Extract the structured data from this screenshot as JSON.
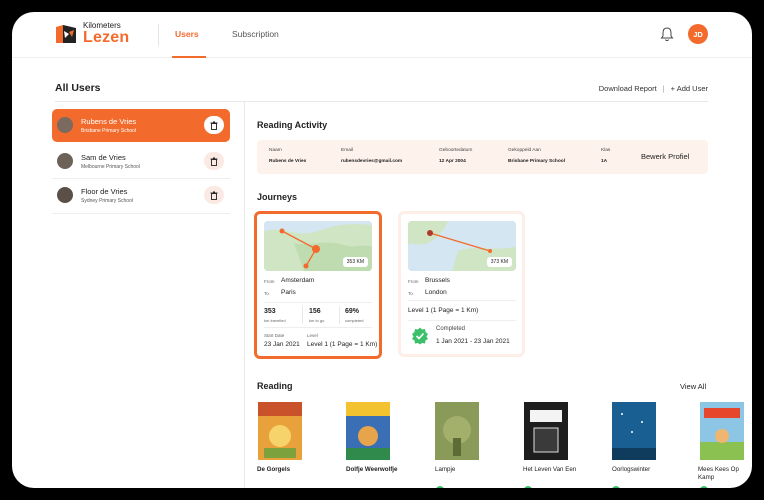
{
  "header": {
    "logo_small": "Kilometers",
    "logo_big": "Lezen",
    "nav": {
      "users": "Users",
      "subscription": "Subscription"
    },
    "avatar_initials": "JD"
  },
  "users_panel": {
    "title": "All Users",
    "download_report": "Download Report",
    "separator": "|",
    "add_user": "+ Add User",
    "users": [
      {
        "name": "Rubens de Vries",
        "school": "Brisbane Primary School",
        "active": true
      },
      {
        "name": "Sam de Vries",
        "school": "Melbourne Primary School",
        "active": false
      },
      {
        "name": "Floor de Vries",
        "school": "Sydney Primary School",
        "active": false
      }
    ]
  },
  "reading_activity": {
    "title": "Reading Activity",
    "columns": [
      {
        "label": "Naam",
        "value": "Rubens de Vries"
      },
      {
        "label": "Email",
        "value": "rubensdevries@gmail.com"
      },
      {
        "label": "Geboortedatum",
        "value": "12 Apr 2004"
      },
      {
        "label": "Gekoppeld Aan",
        "value": "Brisbane Primary School"
      },
      {
        "label": "Klas",
        "value": "1A"
      }
    ],
    "edit_label": "Bewerk Profiel"
  },
  "journeys": {
    "title": "Journeys",
    "cards": [
      {
        "km": "353 KM",
        "from_label": "From",
        "from": "Amsterdam",
        "to_label": "To",
        "to": "Paris",
        "stats": [
          {
            "value": "353",
            "label": "km travelled"
          },
          {
            "value": "156",
            "label": "km to go"
          },
          {
            "value": "69%",
            "label": "completed"
          }
        ],
        "start_label": "Start Date",
        "start": "23 Jan 2021",
        "level_label": "Level",
        "level": "Level 1 (1 Page = 1 Km)"
      },
      {
        "km": "373 KM",
        "from_label": "From",
        "from": "Brussels",
        "to_label": "To",
        "to": "London",
        "level": "Level 1 (1 Page = 1 Km)",
        "status": "Completed",
        "dates": "1 Jan 2021 - 23 Jan 2021"
      }
    ]
  },
  "reading": {
    "title": "Reading",
    "view_all": "View All",
    "books": [
      {
        "title": "De Gorgels",
        "bold": true,
        "color": "#e9a23b"
      },
      {
        "title": "Dolfje Weerwolfje",
        "bold": true,
        "color": "#3a6fb5"
      },
      {
        "title": "Lampje",
        "bold": false,
        "color": "#7b8a4a"
      },
      {
        "title": "Het Leven Van Een",
        "bold": false,
        "color": "#2b2b2b"
      },
      {
        "title": "Oorlogswinter",
        "bold": false,
        "color": "#1d6fa8"
      },
      {
        "title": "Mees Kees Op Kamp",
        "bold": false,
        "color": "#6bb0d6"
      }
    ]
  },
  "colors": {
    "accent": "#F26B2D",
    "success": "#3cbf6b"
  }
}
